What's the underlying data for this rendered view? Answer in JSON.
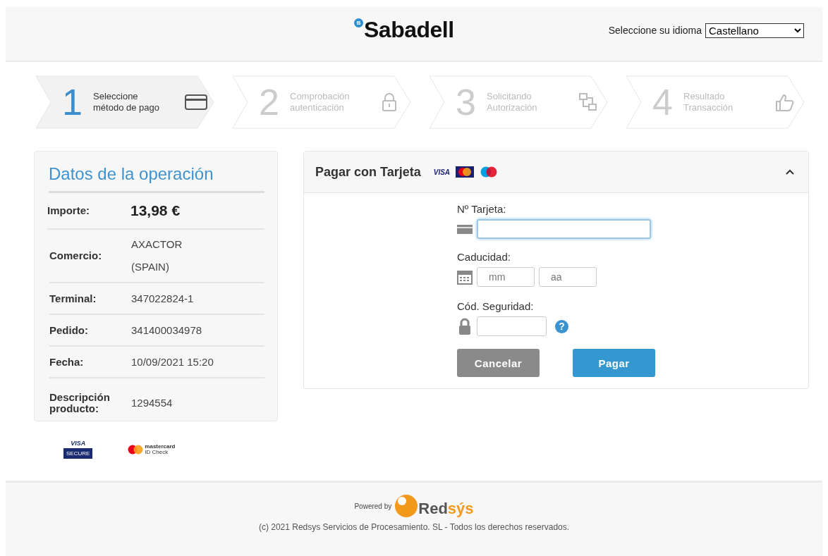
{
  "header": {
    "logo": "Sabadell",
    "logo_mark": "B",
    "language_label": "Seleccione su idioma",
    "language": "Castellano"
  },
  "steps": [
    {
      "number": "1",
      "lines": [
        "Seleccione",
        "método de pago"
      ],
      "selected": true
    },
    {
      "number": "2",
      "lines": [
        "Comprobación",
        "autenticación"
      ],
      "selected": false
    },
    {
      "number": "3",
      "lines": [
        "Solicitando",
        "Autorización"
      ],
      "selected": false
    },
    {
      "number": "4",
      "lines": [
        "Resultado",
        "Transacción"
      ],
      "selected": false
    }
  ],
  "operation": {
    "title": "Datos de la operación",
    "rows": [
      {
        "label": [
          "Importe:"
        ],
        "value": [
          "13,98 €"
        ],
        "kind": "amount"
      },
      {
        "label": [
          "Comercio:"
        ],
        "value": [
          "AXACTOR",
          "(SPAIN)"
        ],
        "kind": "text"
      },
      {
        "label": [
          "Terminal:"
        ],
        "value": [
          "347022824-1"
        ],
        "kind": "text"
      },
      {
        "label": [
          "Pedido:"
        ],
        "value": [
          "341400034978"
        ],
        "kind": "text"
      },
      {
        "label": [
          "Fecha:"
        ],
        "value": [
          "10/09/2021  15:20"
        ],
        "kind": "text"
      },
      {
        "label": [
          "Descripción",
          "producto:"
        ],
        "value": [
          "1294554"
        ],
        "kind": "text"
      }
    ]
  },
  "secure_badges": [
    {
      "kind": "visa",
      "lines": [
        "VISA",
        "SECURE"
      ]
    },
    {
      "kind": "mastercard",
      "lines": [
        "mastercard",
        "ID Check"
      ]
    }
  ],
  "payment": {
    "title": "Pagar con Tarjeta",
    "card_logo_text": "VISA",
    "expanded": true,
    "fields": [
      {
        "label": "Nº Tarjeta:",
        "inputs": [
          {
            "focused": true
          }
        ]
      },
      {
        "label": "Caducidad:",
        "inputs": [
          {
            "placeholder": "mm",
            "focused": false
          },
          {
            "placeholder": "aa",
            "focused": false
          }
        ]
      },
      {
        "label": "Cód. Seguridad:",
        "help": "?",
        "inputs": [
          {
            "focused": false
          }
        ]
      }
    ],
    "buttons": [
      {
        "label": "Cancelar",
        "kind": "secondary"
      },
      {
        "label": "Pagar",
        "kind": "primary"
      }
    ]
  },
  "footer": {
    "powered_by": "Powered by",
    "brand": "Red",
    "brand_accent": "sýs",
    "copyright": "(c) 2021 Redsys Servicios de Procesamiento. SL - Todos los derechos reservados."
  }
}
